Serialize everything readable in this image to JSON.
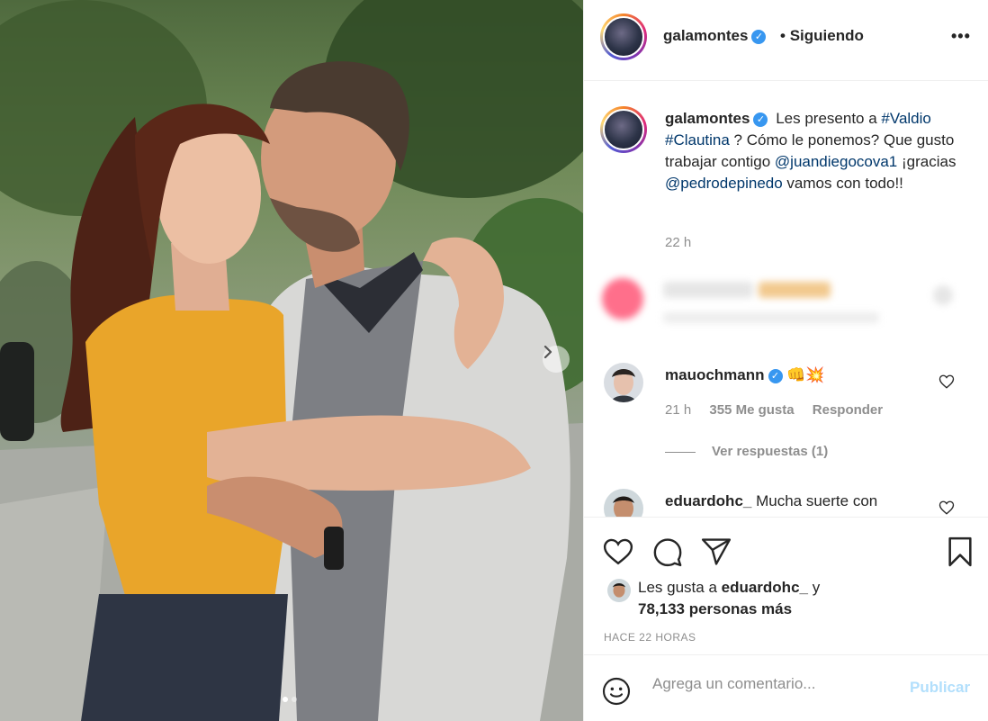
{
  "post": {
    "username": "galamontes",
    "follow_status": "Siguiendo",
    "separator": "•",
    "more_label": "•••",
    "verified_mark": "✓"
  },
  "caption": {
    "username": "galamontes",
    "text_1": "Les presento a ",
    "hashtag_1": "#Valdio",
    "hashtag_2": "#Clautina",
    "text_2": " ? Cómo le ponemos? Que gusto trabajar contigo ",
    "mention_1": "@juandiegocova1",
    "text_3": " ¡gracias ",
    "mention_2": "@pedrodepinedo",
    "text_4": " vamos con todo!!",
    "time": "22 h"
  },
  "comments": [
    {
      "username": "mauochmann",
      "verified": true,
      "text": "👊💥",
      "time": "21 h",
      "likes": "355 Me gusta",
      "reply": "Responder",
      "view_replies": "Ver respuestas (1)"
    },
    {
      "username": "eduardohc_",
      "text": "Mucha suerte con"
    }
  ],
  "likes": {
    "prefix": "Les gusta a ",
    "user": "eduardohc_",
    "connector": " y",
    "count_text": "78,133 personas más"
  },
  "post_time": "HACE 22 HORAS",
  "add_comment": {
    "placeholder": "Agrega un comentario...",
    "publish": "Publicar"
  },
  "icons": {
    "heart": "heart-icon",
    "comment": "comment-icon",
    "share": "share-icon",
    "save": "bookmark-icon",
    "emoji": "emoji-icon",
    "next": "chevron-right-icon"
  },
  "colors": {
    "accent": "#3897f0",
    "link": "#00376b",
    "muted": "#8e8e8e",
    "publish_disabled": "#b2dffc",
    "shirt": "#e9a52a",
    "jacket": "#d8d8d6"
  },
  "carousel": {
    "count": 2,
    "active": 1
  }
}
